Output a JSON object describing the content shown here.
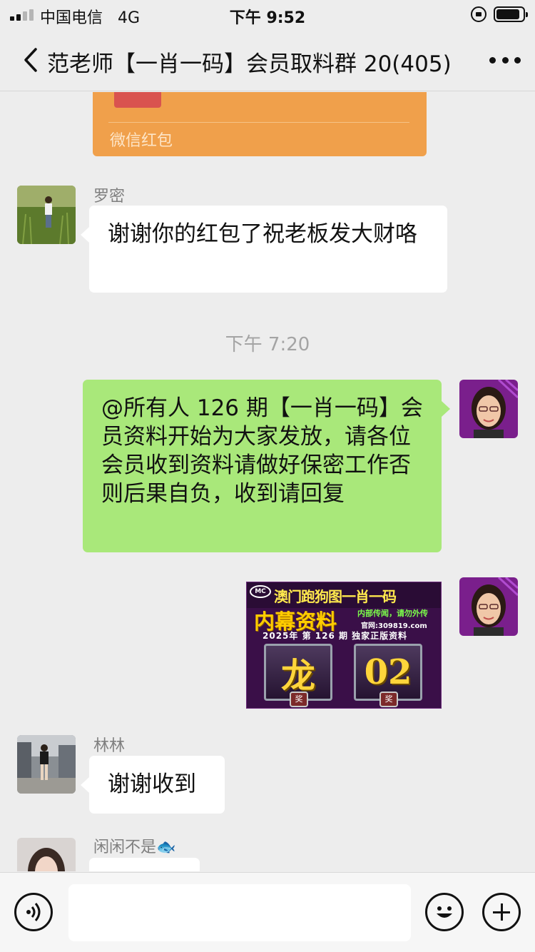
{
  "status_bar": {
    "carrier": "中国电信",
    "network": "4G",
    "time": "下午 9:52"
  },
  "nav": {
    "title": "范老师【一肖一码】会员取料群 20(405)"
  },
  "messages": {
    "redpacket_label": "微信红包",
    "m1_sender": "罗密",
    "m1_text": "谢谢你的红包了祝老板发大财咯",
    "timestamp": "下午 7:20",
    "m2_text": "@所有人 126 期【一肖一码】会员资料开始为大家发放，请各位会员收到资料请做好保密工作否则后果自负，收到请回复",
    "m3_image": {
      "logo": "MC",
      "title": "澳门跑狗图一肖一码",
      "subtitle": "内幕资料",
      "slogan": "内部传闻，请勿外传",
      "site": "官网:309819.com",
      "issue_line": "2025年 第 126 期 独家正版资料",
      "zodiac": "龙",
      "number": "02",
      "seal": "奖"
    },
    "m4_sender": "林林",
    "m4_text": "谢谢收到",
    "m5_sender": "闲闲不是🐟"
  },
  "colors": {
    "bubble_green": "#a9e87a",
    "redpacket_orange": "#f0a04b",
    "background": "#ededed"
  },
  "icons": {
    "back": "chevron-left-icon",
    "more": "more-dots-icon",
    "voice": "voice-icon",
    "emoji": "emoji-icon",
    "plus": "plus-icon"
  }
}
